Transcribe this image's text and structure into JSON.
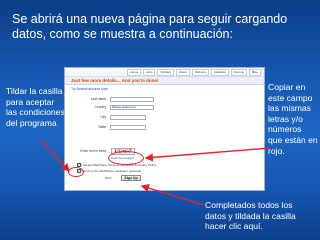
{
  "heading": "Se abrirá una nueva página para seguir cargando datos, como se muestra a continuación:",
  "left_note": "Tildar la casilla para aceptar las condiciones del programa",
  "right_note": "Copiar en este campo las mismas letras y/o números que están en rojo.",
  "bottom_note": "Completados todos los datos y tildada la casilla hacer clic aquí.",
  "screenshot": {
    "nav": [
      "Home",
      "Help",
      "Contact",
      "About",
      "Partners",
      "Features",
      "Forums",
      "Blog"
    ],
    "title": "Just few more details... And you're done!",
    "subtitle": "Try Default account type",
    "fields": [
      {
        "label": "Last name:"
      },
      {
        "label": "Country:",
        "value": "Please select one"
      },
      {
        "label": "City:"
      },
      {
        "label": "State:"
      }
    ],
    "captcha_label": "Enter text in send:",
    "captcha_text": "EU4C7",
    "cant_read": "Can't see image?",
    "terms_text": "I accept WebShare Terms & Conditions & Privacy Policy",
    "newsletter_text": "Send me the WebShare newsletter (optional)",
    "back_label": "Back",
    "signup_label": "Sign Up"
  },
  "colors": {
    "annotation": "#e3242b",
    "background": "#1656b0"
  }
}
